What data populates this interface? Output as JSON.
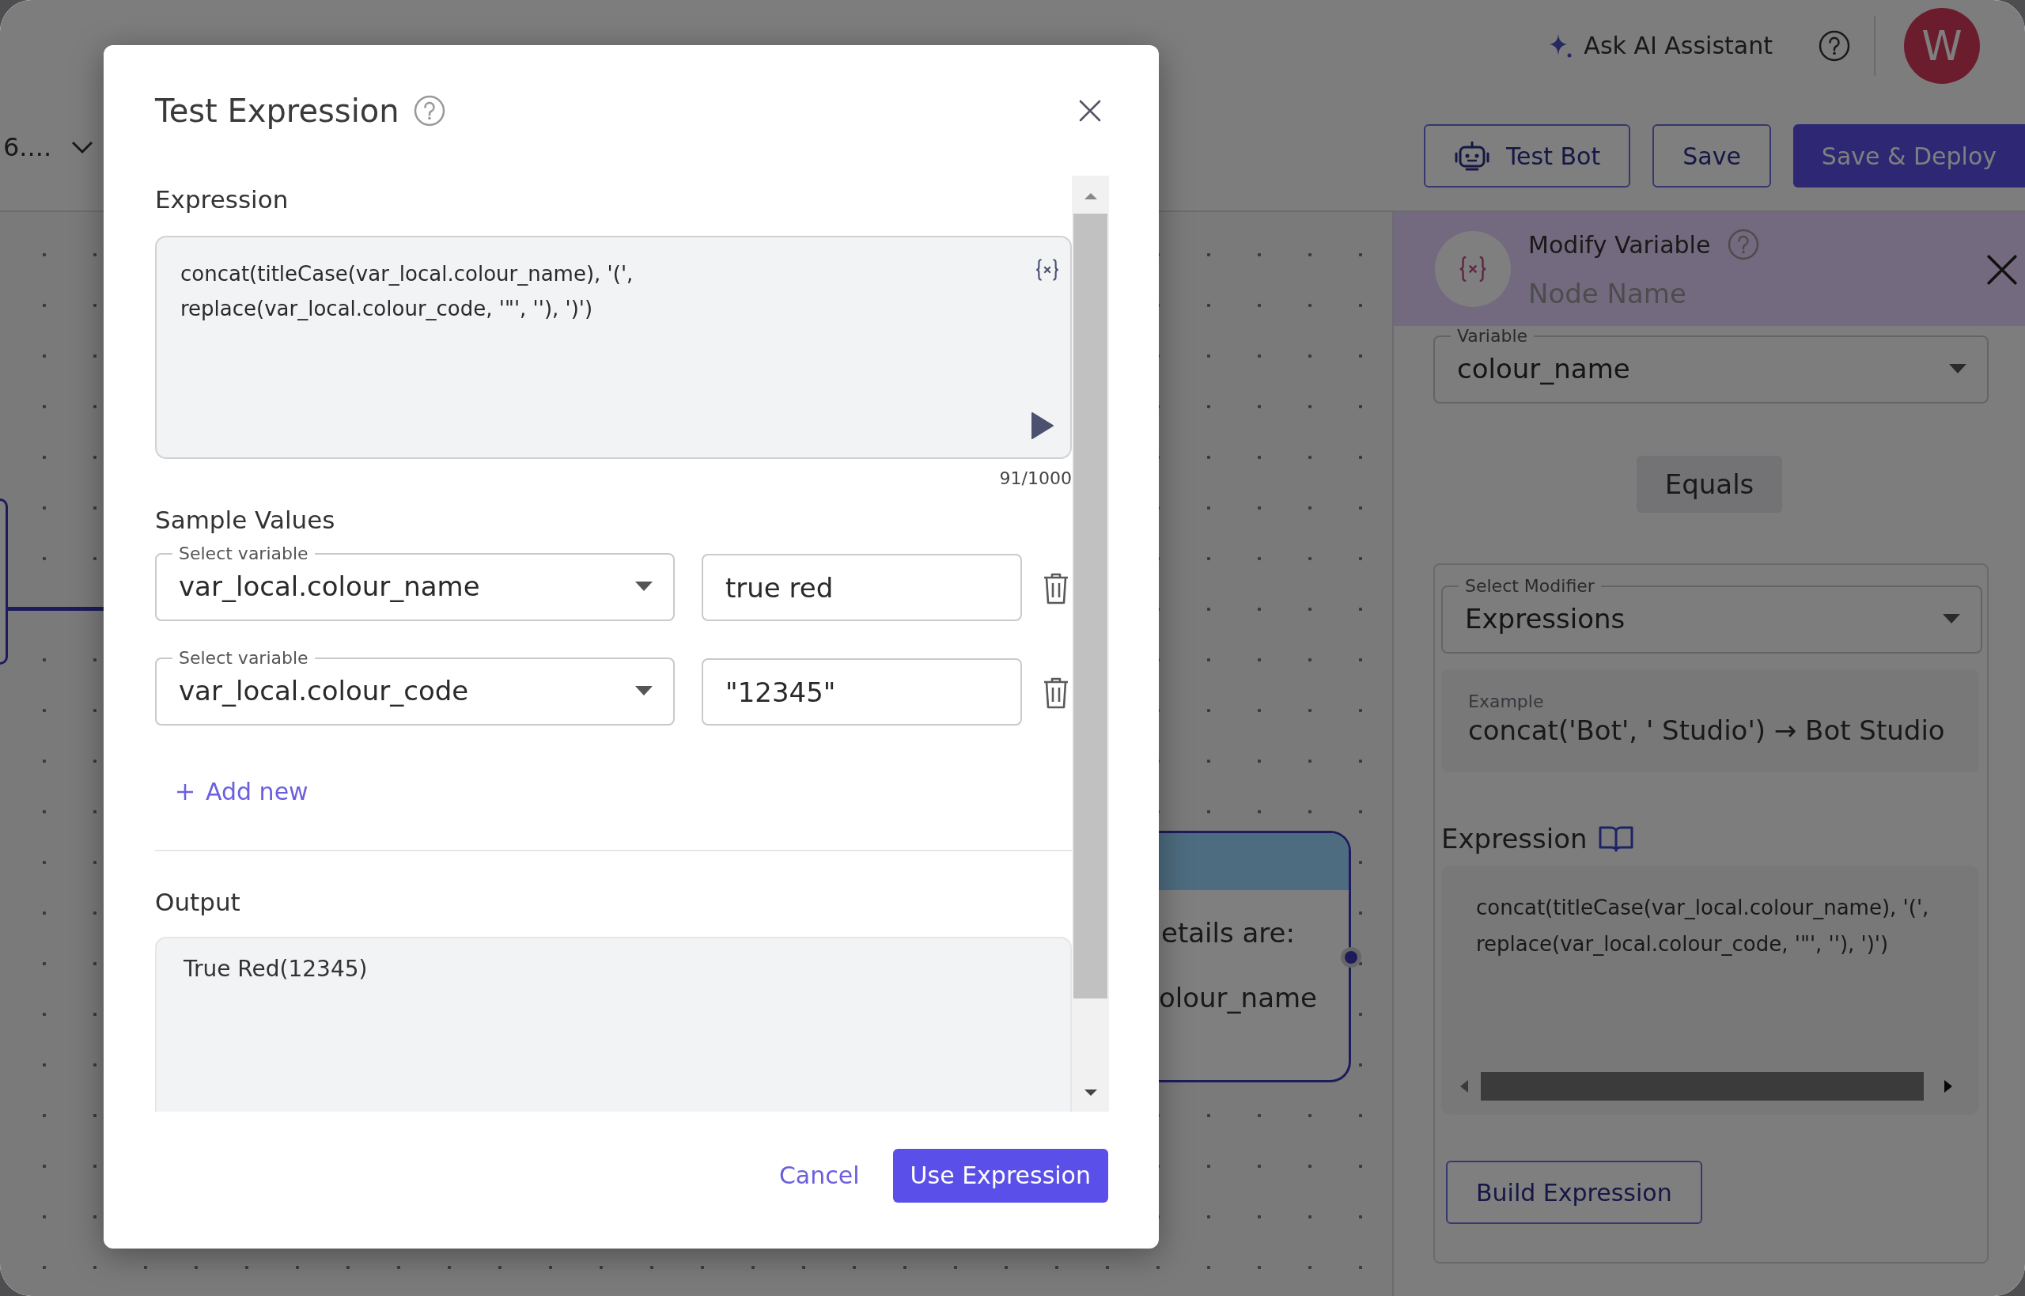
{
  "topbar": {
    "project_menu": "6....",
    "ai_assistant": "Ask AI Assistant",
    "avatar": "W",
    "buttons": [
      {
        "label": "Test Bot",
        "kind": "icon-outline"
      },
      {
        "label": "Save",
        "kind": "outline"
      },
      {
        "label": "Save & Deploy",
        "kind": "primary"
      }
    ]
  },
  "canvas": {
    "node_lines": [
      "etails are:",
      "olour_name"
    ]
  },
  "panel": {
    "title": "Modify Variable",
    "node_name_placeholder": "Node Name",
    "variable": {
      "label": "Variable",
      "value": "colour_name"
    },
    "operator": "Equals",
    "modifier": {
      "label": "Select Modifier",
      "value": "Expressions"
    },
    "example": {
      "label": "Example",
      "text": "concat('Bot', ' Studio') → Bot Studio"
    },
    "expression": {
      "label": "Expression",
      "value": "concat(titleCase(var_local.colour_name), '(', replace(var_local.colour_code, '\"', ''), ')')"
    },
    "build_button": "Build Expression"
  },
  "dialog": {
    "title": "Test Expression",
    "expression_label": "Expression",
    "expression": "concat(titleCase(var_local.colour_name), '(', replace(var_local.colour_code, '\"', ''), ')')",
    "counter": "91/1000",
    "sample_values_label": "Sample Values",
    "samples": [
      {
        "label": "Select variable",
        "variable": "var_local.colour_name",
        "value": "true red"
      },
      {
        "label": "Select variable",
        "variable": "var_local.colour_code",
        "value": "\"12345\""
      }
    ],
    "add_new": "Add new",
    "output_label": "Output",
    "output": "True Red(12345)",
    "buttons": [
      {
        "label": "Cancel",
        "kind": "text"
      },
      {
        "label": "Use Expression",
        "kind": "primary"
      }
    ]
  }
}
